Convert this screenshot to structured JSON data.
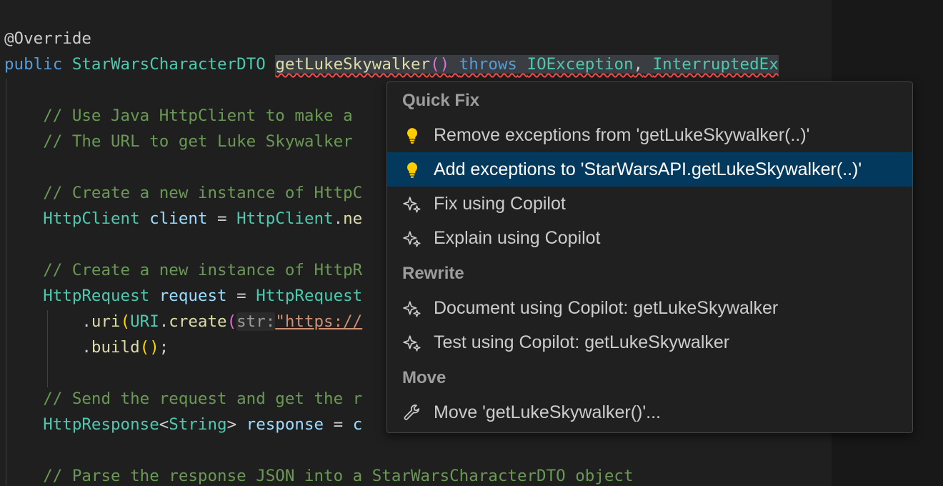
{
  "editor": {
    "line_override": "@Override",
    "sig": {
      "kw_public": "public",
      "return_type": "StarWarsCharacterDTO",
      "method_name": "getLukeSkywalker",
      "parens": "()",
      "kw_throws": "throws",
      "exc1": "IOException",
      "comma": ",",
      "exc2": "InterruptedEx"
    },
    "comment1": "// Use Java HttpClient to make a",
    "comment2": "// The URL to get Luke Skywalker",
    "comment3": "// Create a new instance of HttpC",
    "client_line": {
      "type": "HttpClient",
      "var": "client",
      "eq": "=",
      "cls": "HttpClient",
      "dot": ".",
      "call": "ne"
    },
    "comment4": "// Create a new instance of HttpR",
    "request_line": {
      "type": "HttpRequest",
      "var": "request",
      "eq": "=",
      "cls": "HttpRequest"
    },
    "uri_line": {
      "dot": ".",
      "method": "uri",
      "paren": "(",
      "cls": "URI",
      "dot2": ".",
      "create": "create",
      "paren2": "(",
      "hint": "str:",
      "url": "\"https://"
    },
    "build_line": {
      "dot": ".",
      "method": "build",
      "parens": "()",
      "semi": ";"
    },
    "comment5": "// Send the request and get the r",
    "response_line": {
      "type": "HttpResponse",
      "lt": "<",
      "generic": "String",
      "gt": ">",
      "var": "response",
      "eq": "=",
      "rest": "c"
    },
    "comment6": "// Parse the response JSON into a StarWarsCharacterDTO object"
  },
  "quick_fix_menu": {
    "sections": [
      {
        "header": "Quick Fix",
        "items": [
          {
            "label": "Remove exceptions from 'getLukeSkywalker(..)'",
            "icon": "lightbulb-icon"
          },
          {
            "label": "Add exceptions to 'StarWarsAPI.getLukeSkywalker(..)'",
            "icon": "lightbulb-icon",
            "selected": true
          },
          {
            "label": "Fix using Copilot",
            "icon": "sparkle-icon"
          },
          {
            "label": "Explain using Copilot",
            "icon": "sparkle-icon"
          }
        ]
      },
      {
        "header": "Rewrite",
        "items": [
          {
            "label": "Document using Copilot: getLukeSkywalker",
            "icon": "sparkle-icon"
          },
          {
            "label": "Test using Copilot: getLukeSkywalker",
            "icon": "sparkle-icon"
          }
        ]
      },
      {
        "header": "Move",
        "items": [
          {
            "label": "Move 'getLukeSkywalker()'...",
            "icon": "wrench-icon"
          }
        ]
      }
    ]
  },
  "colors": {
    "selected_bg": "#04395e",
    "lightbulb": "#ffcc00",
    "error_squiggle": "#f14c4c"
  }
}
